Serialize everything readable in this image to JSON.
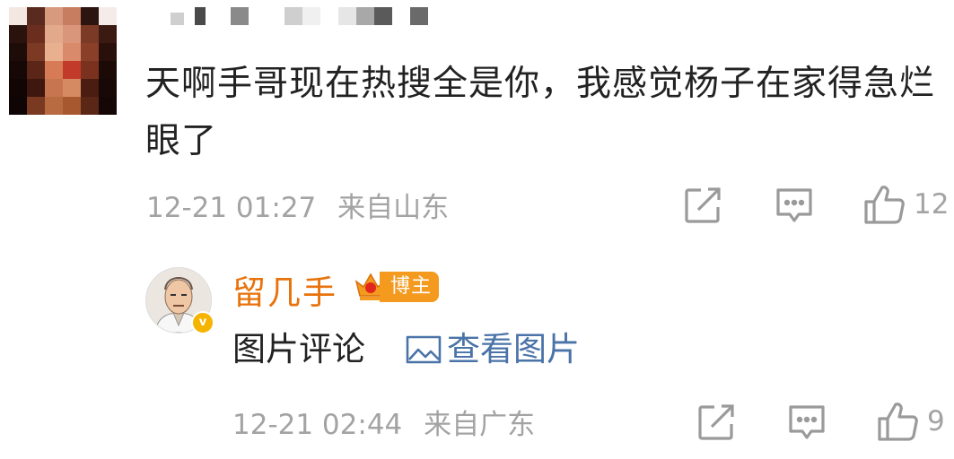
{
  "comment": {
    "text": "天啊手哥现在热搜全是你，我感觉杨子在家得急烂眼了",
    "timestamp": "12-21 01:27",
    "location": "来自山东",
    "like_count": "12",
    "icons": [
      "share-icon",
      "comment-icon",
      "like-icon"
    ]
  },
  "reply": {
    "author": "留几手",
    "badge": "博主",
    "text": "图片评论",
    "view_image_label": "查看图片",
    "timestamp": "12-21 02:44",
    "location": "来自广东",
    "like_count": "9",
    "icons": [
      "share-icon",
      "comment-icon",
      "like-icon",
      "image-icon",
      "verified-icon",
      "crown-icon"
    ]
  },
  "colors": {
    "meta_gray": "#a3a3a3",
    "author_orange": "#e8720c",
    "badge_orange": "#f39a1f",
    "link_blue": "#4a73a8",
    "verified_yellow": "#f5b400"
  }
}
